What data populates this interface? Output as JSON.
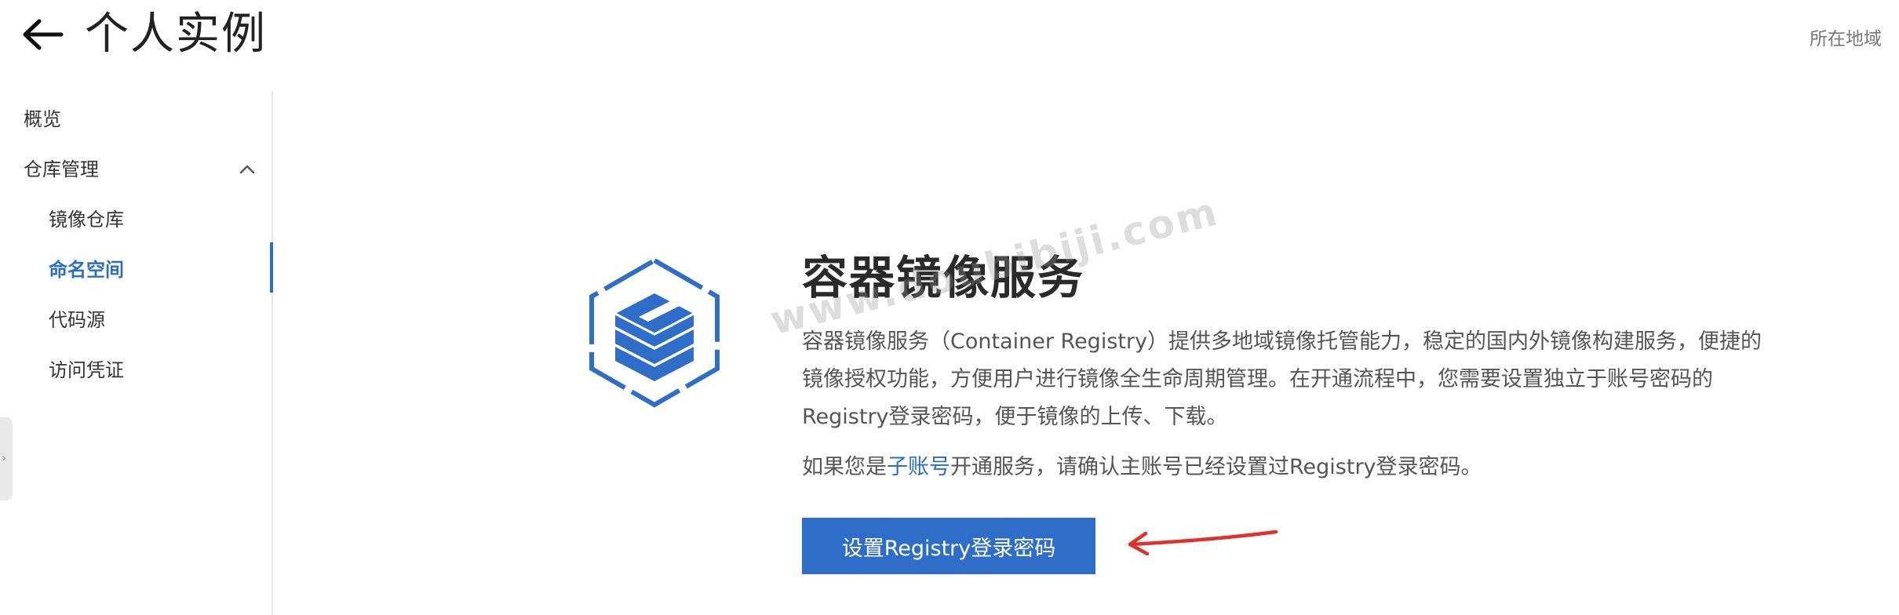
{
  "header": {
    "title": "个人实例",
    "region_label": "所在地域"
  },
  "sidebar": {
    "items": [
      {
        "label": "概览"
      },
      {
        "label": "仓库管理"
      },
      {
        "label": "镜像仓库"
      },
      {
        "label": "命名空间"
      },
      {
        "label": "代码源"
      },
      {
        "label": "访问凭证"
      }
    ],
    "active_item": "命名空间"
  },
  "hero": {
    "title": "容器镜像服务",
    "description": "容器镜像服务（Container Registry）提供多地域镜像托管能力，稳定的国内外镜像构建服务，便捷的镜像授权功能，方便用户进行镜像全生命周期管理。在开通流程中，您需要设置独立于账号密码的Registry登录密码，便于镜像的上传、下载。",
    "note_prefix": "如果您是",
    "note_link": "子账号",
    "note_suffix": "开通服务，请确认主账号已经设置过Registry登录密码。",
    "button_label": "设置Registry登录密码"
  },
  "watermark": "www.doubibiji.com",
  "icons": {
    "back": "arrow-left-icon",
    "collapse": "chevron-up-icon",
    "logo": "container-registry-logo",
    "annotation": "red-arrow-annotation"
  },
  "colors": {
    "accent": "#2f6ec8",
    "active_text": "#2b6fc2",
    "annotation": "#e0302a"
  }
}
